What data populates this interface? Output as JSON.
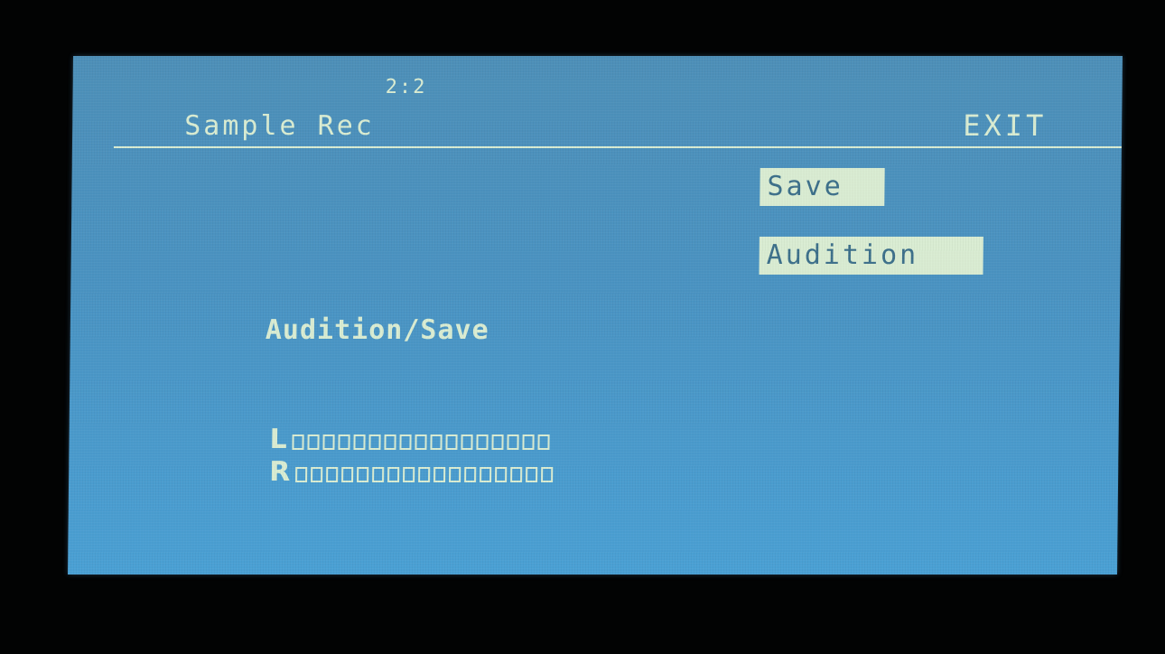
{
  "header": {
    "counter": "2:2",
    "title": "Sample Rec",
    "exit_label": "EXIT"
  },
  "actions": {
    "save_label": "Save",
    "audition_label": "Audition"
  },
  "main": {
    "heading": "Audition/Save"
  },
  "meters": [
    {
      "channel": "L",
      "segments": 17,
      "level": 0
    },
    {
      "channel": "R",
      "segments": 17,
      "level": 0
    }
  ],
  "colors": {
    "screen_background": "#4a93c2",
    "foreground": "#d9ecd2",
    "button_text": "#3c6f8a"
  }
}
